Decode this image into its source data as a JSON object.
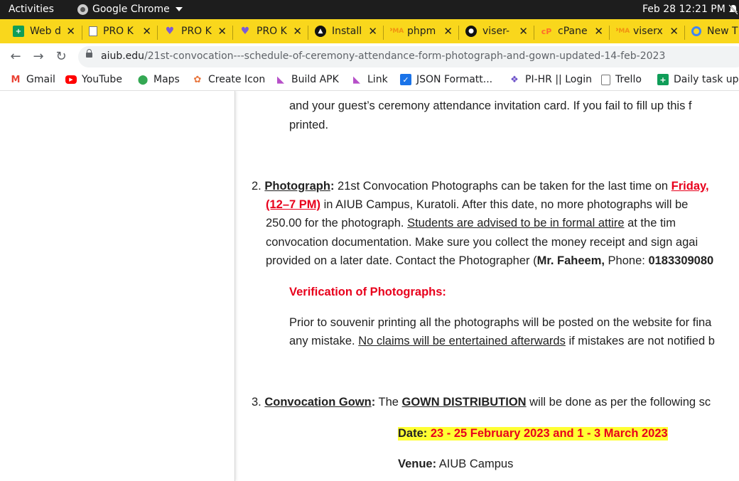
{
  "topbar": {
    "activities": "Activities",
    "app": "Google Chrome",
    "clock": "Feb 28  12:21 PM"
  },
  "tabs": [
    {
      "title": "Web d",
      "icon": "sheets-icon",
      "color": "#0f9d58"
    },
    {
      "title": "PRO K",
      "icon": "page-icon",
      "color": "#777777"
    },
    {
      "title": "PRO K",
      "icon": "purple-logo-icon",
      "color": "#7b5cd6"
    },
    {
      "title": "PRO K",
      "icon": "purple-logo-icon",
      "color": "#7b5cd6"
    },
    {
      "title": "Install",
      "icon": "triangle-logo-icon",
      "color": "#111111"
    },
    {
      "title": "phpm",
      "icon": "phpmyadmin-icon",
      "color": "#f29111"
    },
    {
      "title": "viser-",
      "icon": "github-icon",
      "color": "#111111"
    },
    {
      "title": "cPane",
      "icon": "cpanel-icon",
      "color": "#ff6c2c"
    },
    {
      "title": "viserx",
      "icon": "phpmyadmin-icon",
      "color": "#f29111"
    },
    {
      "title": "New T",
      "icon": "chrome-icon",
      "color": "#4285f4"
    }
  ],
  "address": {
    "host": "aiub.edu",
    "path": "/21st-convocation---schedule-of-ceremony-attendance-form-photograph-and-gown-updated-14-feb-2023"
  },
  "bookmarks": [
    {
      "label": "Gmail",
      "icon": "gmail-icon",
      "color": "#ea4335"
    },
    {
      "label": "YouTube",
      "icon": "youtube-icon",
      "color": "#ff0000"
    },
    {
      "label": "Maps",
      "icon": "maps-icon",
      "color": "#34a853"
    },
    {
      "label": "Create Icon",
      "icon": "create-icon-icon",
      "color": "#e8743b"
    },
    {
      "label": "Build APK",
      "icon": "build-apk-icon",
      "color": "#b64fc8"
    },
    {
      "label": "Link",
      "icon": "link-icon",
      "color": "#b64fc8"
    },
    {
      "label": "JSON Formatt...",
      "icon": "checkbox-icon",
      "color": "#1a73e8"
    },
    {
      "label": "PI-HR || Login",
      "icon": "pihr-icon",
      "color": "#6b4fc8"
    },
    {
      "label": "Trello",
      "icon": "trello-icon",
      "color": "#777777"
    },
    {
      "label": "Daily task upd",
      "icon": "sheets-icon",
      "color": "#0f9d58"
    }
  ],
  "article": {
    "intro_line1": "and your guest’s ceremony attendance invitation card. If you fail to fill up this f",
    "intro_line2": "printed.",
    "photo": {
      "num": "2.",
      "heading": "Photograph",
      "colon": ":",
      "l1_text": " 21st Convocation Photographs can be taken for the last time on ",
      "l1_red": "Friday,",
      "l2_red": "(12–7 PM)",
      "l2_text": " in AIUB Campus, Kuratoli. After this date, no more photographs will be",
      "l3_text": "250.00 for the photograph. ",
      "l3_underline": "Students are advised to be in formal attire",
      "l3_text2": " at the tim",
      "l4_text": "convocation documentation. Make sure you collect the money receipt and sign agai",
      "l5_text": "provided on a later date. Contact the Photographer (",
      "l5_bold": "Mr. Faheem,",
      "l5_text2": " Phone: ",
      "l5_bold2": "0183309080"
    },
    "verification": {
      "heading": "Verification of Photographs:",
      "l1": "Prior to souvenir printing all the photographs will be posted on the website for fina",
      "l2_text": "any mistake. ",
      "l2_underline": "No claims will be entertained afterwards",
      "l2_text2": " if mistakes are not notified b"
    },
    "gown": {
      "num": "3.",
      "heading": "Convocation Gown",
      "colon": ":",
      "text1": " The ",
      "bold_underline": "GOWN DISTRIBUTION",
      "text2": " will be done as per the following sc",
      "date_label": "Date:",
      "date_value": " 23 - 25 February 2023 and 1 - 3 March 2023",
      "venue_label": "Venue:",
      "venue_value": " AIUB Campus"
    }
  }
}
